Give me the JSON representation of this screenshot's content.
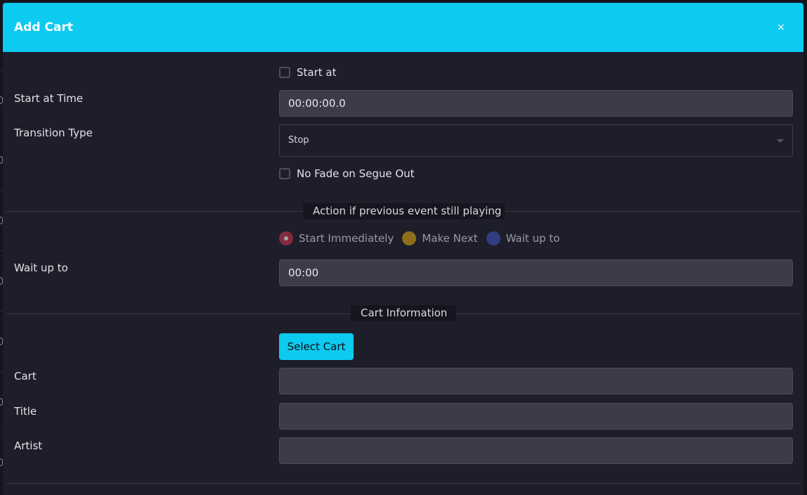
{
  "modal": {
    "title": "Add Cart",
    "close_glyph": "×"
  },
  "schedule": {
    "start_at_label": "Start at",
    "start_at_checked": false,
    "start_time_label": "Start at Time",
    "start_time_value": "00:00:00.0",
    "transition_label": "Transition Type",
    "transition_value": "Stop",
    "no_fade_label": "No Fade on Segue Out",
    "no_fade_checked": false
  },
  "action": {
    "legend": "Action if previous event still playing",
    "options": [
      {
        "label": "Start Immediately",
        "color": "#c0334d",
        "checked": true
      },
      {
        "label": "Make Next",
        "color": "#d4a017",
        "checked": false
      },
      {
        "label": "Wait up to",
        "color": "#3f51b5",
        "checked": false
      }
    ],
    "wait_label": "Wait up to",
    "wait_value": "00:00"
  },
  "cart_info": {
    "legend": "Cart Information",
    "select_button": "Select Cart",
    "cart_label": "Cart",
    "cart_value": "",
    "title_label": "Title",
    "title_value": "",
    "artist_label": "Artist",
    "artist_value": ""
  },
  "colors": {
    "accent": "#0dcaf0",
    "modal_bg": "#1e1e2b",
    "input_bg": "#3b3b4a"
  }
}
